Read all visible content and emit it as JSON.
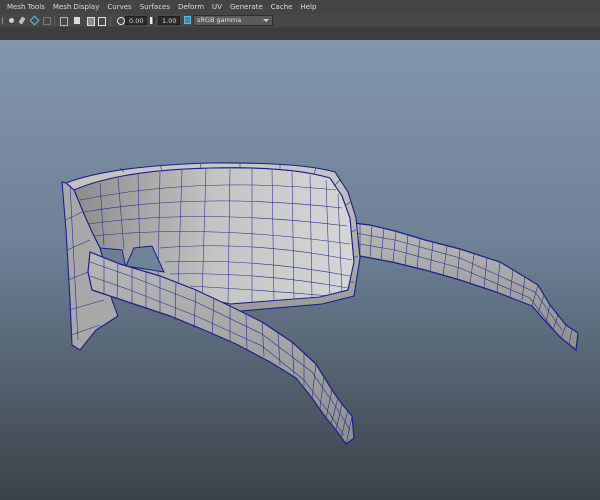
{
  "menubar": {
    "items": [
      "Mesh Tools",
      "Mesh Display",
      "Curves",
      "Surfaces",
      "Deform",
      "UV",
      "Generate",
      "Cache",
      "Help"
    ]
  },
  "toolbar": {
    "exposure_value": "0.00",
    "gamma_value": "1.00",
    "color_space": "sRGB gamma"
  },
  "colors": {
    "menubar_bg": "#444444",
    "toolbar_bg": "#474747",
    "viewport_top": "#8296ad",
    "viewport_bottom": "#3b4148",
    "wireframe": "#1e2a8a",
    "mesh_shade": "#b8b8b8"
  },
  "viewport": {
    "object": "sunglasses-mesh",
    "display_mode": "wireframe-on-shaded"
  }
}
